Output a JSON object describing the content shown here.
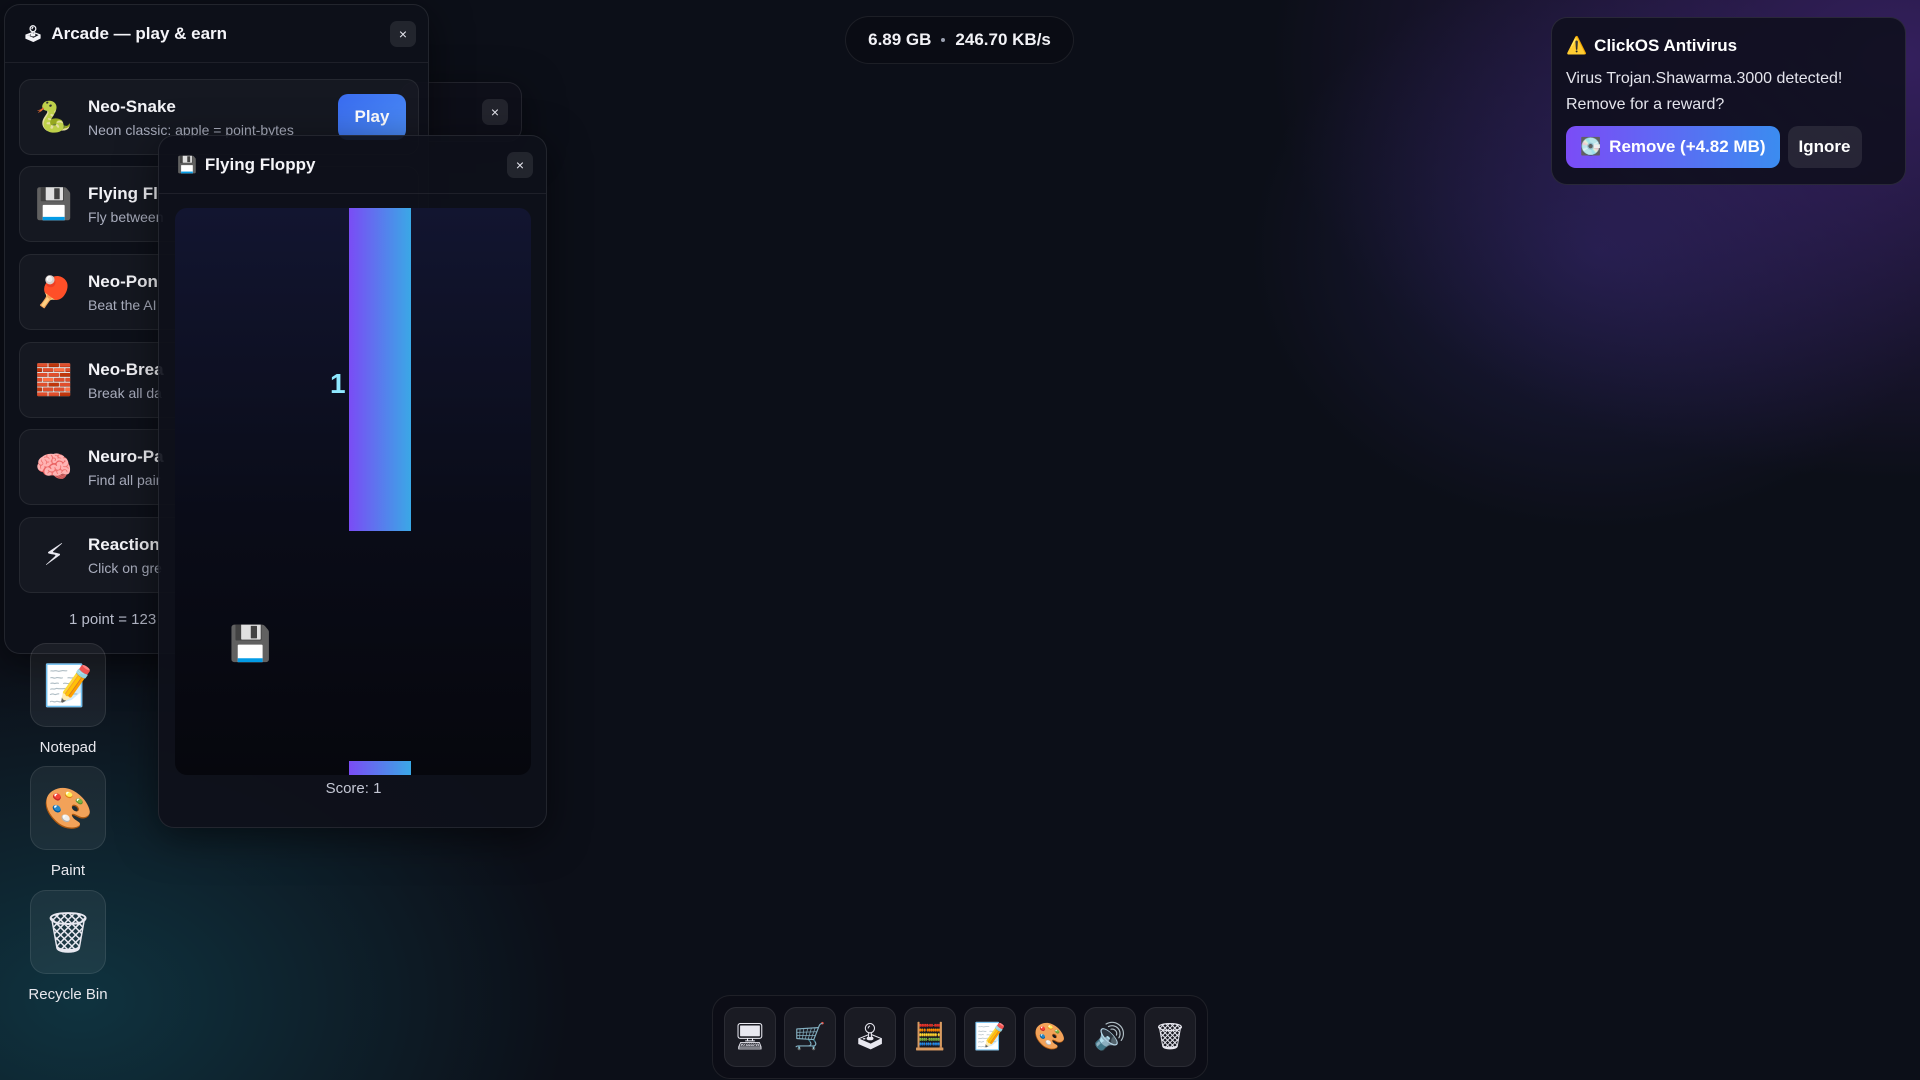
{
  "stats": {
    "storage": "6.89 GB",
    "speed": "246.70 KB/s"
  },
  "arcade": {
    "title": "Arcade — play & earn",
    "title_icon": "joystick-icon",
    "close_label": "×",
    "games": [
      {
        "name": "Neo-Snake",
        "desc": "Neon classic: apple = point-bytes",
        "icon": "snake-icon",
        "glyph": "🐍",
        "play_label": "Play"
      },
      {
        "name": "Flying Fl",
        "desc": "Fly between",
        "icon": "floppy-disk-icon",
        "glyph": "💾"
      },
      {
        "name": "Neo-Pon",
        "desc": "Beat the AI",
        "icon": "ping-pong-icon",
        "glyph": "🏓"
      },
      {
        "name": "Neo-Brea",
        "desc": "Break all da",
        "icon": "bricks-icon",
        "glyph": "🧱"
      },
      {
        "name": "Neuro-Pa",
        "desc": "Find all pair",
        "icon": "brain-icon",
        "glyph": "🧠"
      },
      {
        "name": "Reaction",
        "desc": "Click on gre",
        "icon": "lightning-icon",
        "glyph": "⚡"
      }
    ],
    "footer": "1 point = 123"
  },
  "back_window": {
    "close_label": "×"
  },
  "floppy": {
    "title": "Flying Floppy",
    "title_icon": "floppy-disk-icon",
    "close_label": "×",
    "score_overlay": "1",
    "score_label": "Score: 1",
    "player_glyph": "💾"
  },
  "toast": {
    "title": "ClickOS Antivirus",
    "warning_glyph": "⚠️",
    "message": "Virus Trojan.Shawarma.3000 detected! Remove for a reward?",
    "remove_label": "Remove (+4.82 MB)",
    "remove_glyph": "💽",
    "ignore_label": "Ignore"
  },
  "desktop": [
    {
      "label": "Notepad",
      "icon": "notepad-icon",
      "glyph": "📝"
    },
    {
      "label": "Paint",
      "icon": "palette-icon",
      "glyph": "🎨"
    },
    {
      "label": "Recycle Bin",
      "icon": "trash-icon",
      "glyph": "🗑"
    }
  ],
  "taskbar": [
    {
      "icon": "computer-icon",
      "glyph": "🖥"
    },
    {
      "icon": "shopping-cart-icon",
      "glyph": "🛒"
    },
    {
      "icon": "joystick-icon",
      "glyph": "🕹"
    },
    {
      "icon": "abacus-icon",
      "glyph": "🧮"
    },
    {
      "icon": "notepad-icon",
      "glyph": "📝"
    },
    {
      "icon": "palette-icon",
      "glyph": "🎨"
    },
    {
      "icon": "speaker-icon",
      "glyph": "🔊"
    },
    {
      "icon": "trash-icon",
      "glyph": "🗑"
    }
  ]
}
